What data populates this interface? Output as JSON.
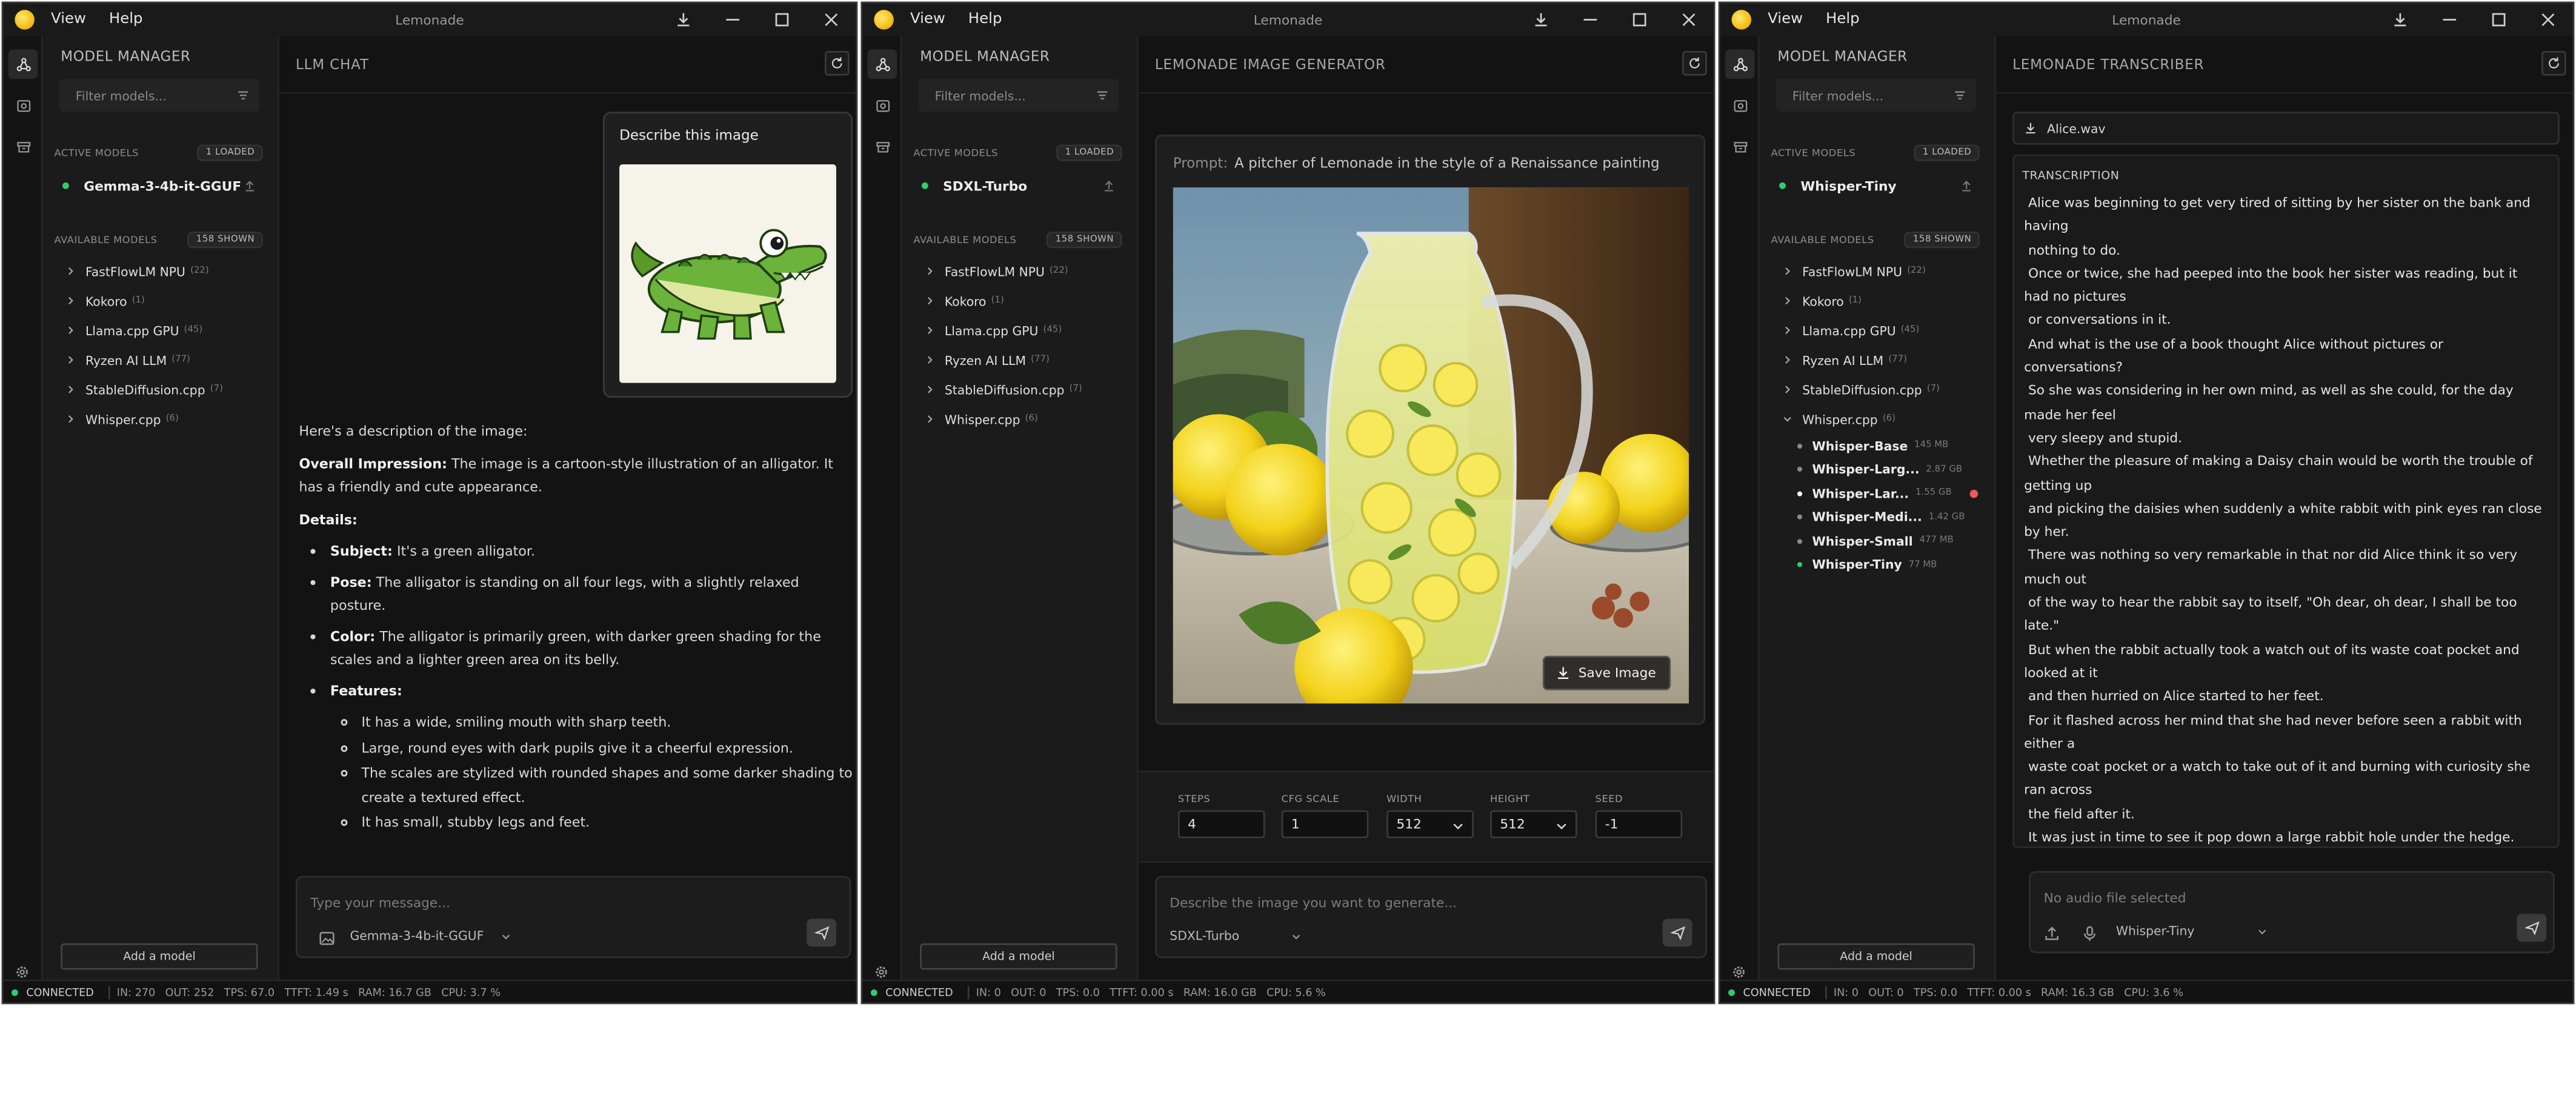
{
  "common": {
    "app_title": "Lemonade",
    "menu": [
      "View",
      "Help"
    ],
    "model_manager_title": "MODEL MANAGER",
    "filter_placeholder": "Filter models...",
    "active_models_label": "ACTIVE MODELS",
    "loaded_badge": "1 LOADED",
    "available_models_label": "AVAILABLE MODELS",
    "shown_badge": "158 SHOWN",
    "add_model_label": "Add a model",
    "connected_label": "CONNECTED",
    "categories": [
      {
        "name": "FastFlowLM NPU",
        "count": "(22)"
      },
      {
        "name": "Kokoro",
        "count": "(1)"
      },
      {
        "name": "Llama.cpp GPU",
        "count": "(45)"
      },
      {
        "name": "Ryzen AI LLM",
        "count": "(77)"
      },
      {
        "name": "StableDiffusion.cpp",
        "count": "(7)"
      },
      {
        "name": "Whisper.cpp",
        "count": "(6)"
      }
    ],
    "colors": {
      "connected": "#2ecc71",
      "active_dot": "#2ecc71",
      "warning_dot": "#e85a5a"
    }
  },
  "window1": {
    "active_model": "Gemma-3-4b-it-GGUF",
    "main_title": "LLM CHAT",
    "user_message": "Describe this image",
    "user_image_icon": "alligator-cartoon-image",
    "reply": {
      "intro": "Here's a description of the image:",
      "overall_label": "Overall Impression:",
      "overall_text": " The image is a cartoon-style illustration of an alligator. It has a friendly and cute appearance.",
      "details_label": "Details:",
      "items": [
        {
          "label": "Subject:",
          "text": " It's a green alligator."
        },
        {
          "label": "Pose:",
          "text": " The alligator is standing on all four legs, with a slightly relaxed posture."
        },
        {
          "label": "Color:",
          "text": " The alligator is primarily green, with darker green shading for the scales and a lighter green area on its belly."
        }
      ],
      "features_label": "Features:",
      "features": [
        "It has a wide, smiling mouth with sharp teeth.",
        "Large, round eyes with dark pupils give it a cheerful expression.",
        "The scales are stylized with rounded shapes and some darker shading to create a textured effect.",
        "It has small, stubby legs and feet."
      ]
    },
    "input_placeholder": "Type your message...",
    "model_select": "Gemma-3-4b-it-GGUF",
    "status": {
      "in": "IN: 270",
      "out": "OUT: 252",
      "tps": "TPS: 67.0",
      "ttft": "TTFT: 1.49 s",
      "ram": "RAM: 16.7 GB",
      "cpu": "CPU: 3.7 %"
    }
  },
  "window2": {
    "active_model": "SDXL-Turbo",
    "main_title": "LEMONADE IMAGE GENERATOR",
    "prompt_label": "Prompt:",
    "prompt_text": "A pitcher of Lemonade in the style of a Renaissance painting",
    "save_label": "Save Image",
    "params": [
      {
        "label": "STEPS",
        "value": "4",
        "select": false
      },
      {
        "label": "CFG SCALE",
        "value": "1",
        "select": false
      },
      {
        "label": "WIDTH",
        "value": "512",
        "select": true
      },
      {
        "label": "HEIGHT",
        "value": "512",
        "select": true
      },
      {
        "label": "SEED",
        "value": "-1",
        "select": false
      }
    ],
    "input_placeholder": "Describe the image you want to generate...",
    "model_select": "SDXL-Turbo",
    "status": {
      "in": "IN: 0",
      "out": "OUT: 0",
      "tps": "TPS: 0.0",
      "ttft": "TTFT: 0.00 s",
      "ram": "RAM: 16.0 GB",
      "cpu": "CPU: 5.6 %"
    }
  },
  "window3": {
    "active_model": "Whisper-Tiny",
    "main_title": "LEMONADE TRANSCRIBER",
    "file_name": "Alice.wav",
    "transcription_label": "TRANSCRIPTION",
    "transcription_text": " Alice was beginning to get very tired of sitting by her sister on the bank and having\n nothing to do.\n Once or twice, she had peeped into the book her sister was reading, but it had no pictures\n or conversations in it.\n And what is the use of a book thought Alice without pictures or conversations?\n So she was considering in her own mind, as well as she could, for the day made her feel\n very sleepy and stupid.\n Whether the pleasure of making a Daisy chain would be worth the trouble of getting up\n and picking the daisies when suddenly a white rabbit with pink eyes ran close by her.\n There was nothing so very remarkable in that nor did Alice think it so very much out\n of the way to hear the rabbit say to itself, \"Oh dear, oh dear, I shall be too late.\"\n But when the rabbit actually took a watch out of its waste coat pocket and looked at it\n and then hurried on Alice started to her feet.\n For it flashed across her mind that she had never before seen a rabbit with either a\n waste coat pocket or a watch to take out of it and burning with curiosity she ran across\n the field after it.\n It was just in time to see it pop down a large rabbit hole under the hedge.\n And another moment, down Alice went after it.\n The rabbit hole went straight on like a tunnel for some way and then dipped",
    "whisper_submodels": [
      {
        "name": "Whisper-Base",
        "size": "145 MB",
        "dot": "#8a8a8a"
      },
      {
        "name": "Whisper-Larg...",
        "size": "2.87 GB",
        "dot": "#8a8a8a"
      },
      {
        "name": "Whisper-Lar...",
        "size": "1.55 GB",
        "dot": "#ffffff"
      },
      {
        "name": "Whisper-Medi...",
        "size": "1.42 GB",
        "dot": "#8a8a8a"
      },
      {
        "name": "Whisper-Small",
        "size": "477 MB",
        "dot": "#8a8a8a"
      },
      {
        "name": "Whisper-Tiny",
        "size": "77 MB",
        "dot": "#2ecc71"
      }
    ],
    "input_placeholder": "No audio file selected",
    "model_select": "Whisper-Tiny",
    "status": {
      "in": "IN: 0",
      "out": "OUT: 0",
      "tps": "TPS: 0.0",
      "ttft": "TTFT: 0.00 s",
      "ram": "RAM: 16.3 GB",
      "cpu": "CPU: 3.6 %"
    }
  }
}
